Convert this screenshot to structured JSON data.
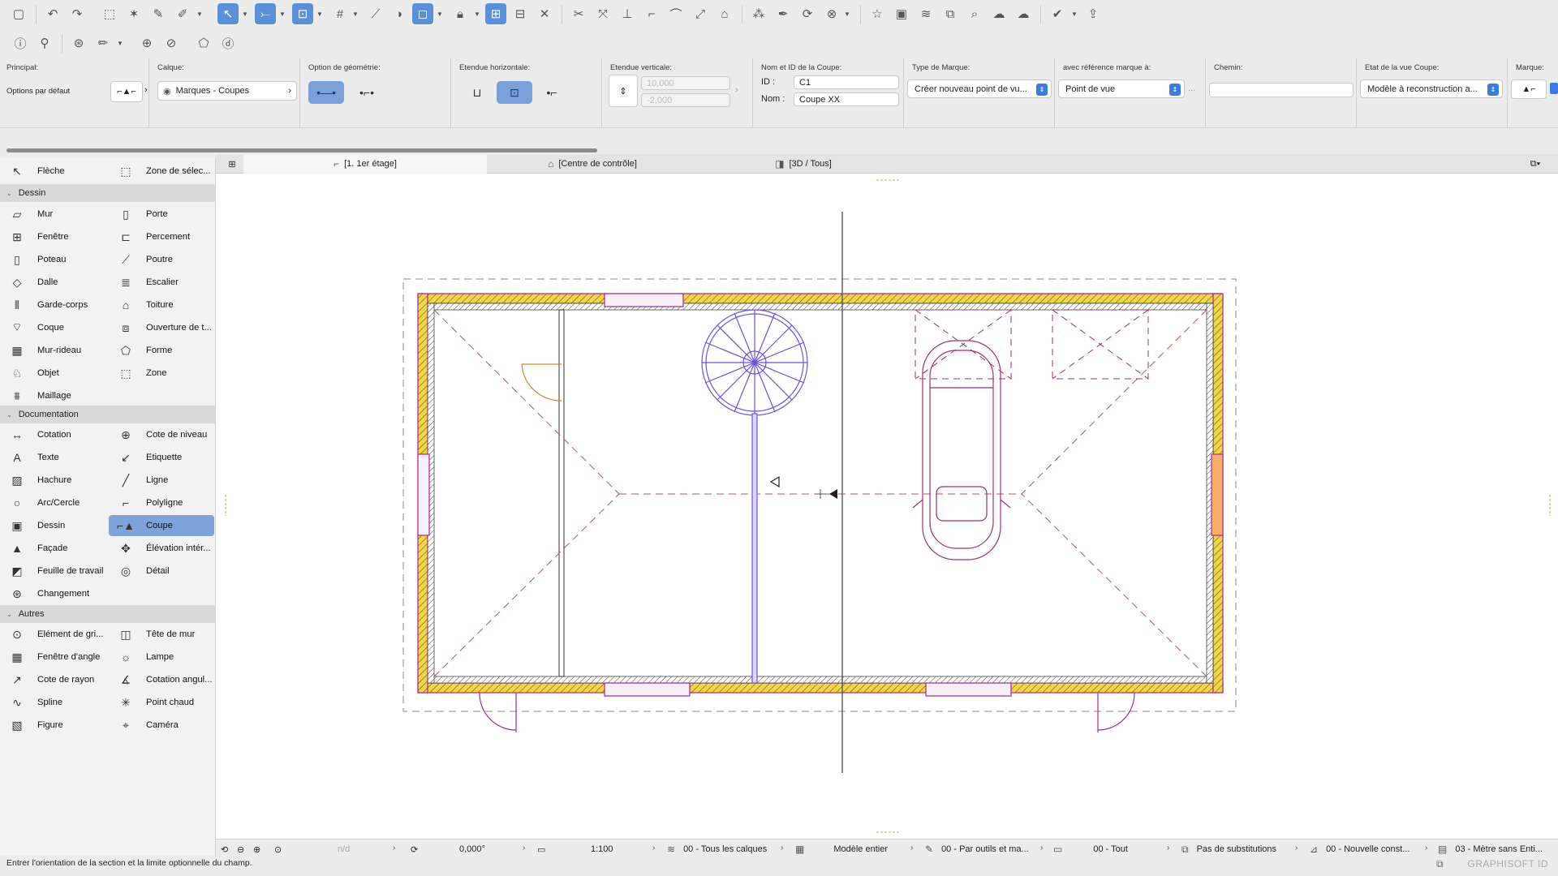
{
  "infobox": {
    "principal": {
      "title": "Principal:",
      "value": "Options par défaut"
    },
    "calque": {
      "title": "Calque:",
      "value": "Marques - Coupes"
    },
    "geometrie": {
      "title": "Option de géométrie:"
    },
    "etendue_h": {
      "title": "Etendue horizontale:"
    },
    "etendue_v": {
      "title": "Etendue verticale:",
      "top": "10,000",
      "bottom": "-2,000"
    },
    "nom_id": {
      "title": "Nom et ID de la Coupe:",
      "id_label": "ID :",
      "id_value": "C1",
      "nom_label": "Nom :",
      "nom_value": "Coupe XX"
    },
    "type_marque": {
      "title": "Type de Marque:",
      "value": "Créer nouveau point de vu..."
    },
    "reference": {
      "title": "avec référence marque à:",
      "value": "Point de vue",
      "more": "..."
    },
    "chemin": {
      "title": "Chemin:",
      "value": ""
    },
    "etat": {
      "title": "Etat de la vue Coupe:",
      "value": "Modèle à reconstruction a..."
    },
    "marque": {
      "title": "Marque:"
    }
  },
  "tabs": [
    {
      "label": "[1. 1er étage]",
      "icon": "floorplan-icon"
    },
    {
      "label": "[Centre de contrôle]",
      "icon": "control-center-icon"
    },
    {
      "label": "[3D / Tous]",
      "icon": "3d-view-icon"
    }
  ],
  "toolbox": {
    "top": [
      {
        "label": "Flèche",
        "icon": "arrow-icon"
      },
      {
        "label": "Zone de sélec...",
        "icon": "marquee-icon"
      }
    ],
    "sections": {
      "dessin": "Dessin",
      "documentation": "Documentation",
      "autres": "Autres"
    },
    "dessin_left": [
      "Mur",
      "Fenêtre",
      "Poteau",
      "Dalle",
      "Garde-corps",
      "Coque",
      "Mur-rideau",
      "Objet",
      "Maillage"
    ],
    "dessin_right": [
      "Porte",
      "Percement",
      "Poutre",
      "Escalier",
      "Toiture",
      "Ouverture de t...",
      "Forme",
      "Zone"
    ],
    "doc_left": [
      "Cotation",
      "Texte",
      "Hachure",
      "Arc/Cercle",
      "Dessin",
      "Façade",
      "Feuille de travail",
      "Changement"
    ],
    "doc_right": [
      "Cote de niveau",
      "Etiquette",
      "Ligne",
      "Polyligne",
      "Coupe",
      "Élévation intér...",
      "Détail"
    ],
    "autres_left": [
      "Elément de gri...",
      "Fenêtre d'angle",
      "Cote de rayon",
      "Spline",
      "Figure"
    ],
    "autres_right": [
      "Tête de mur",
      "Lampe",
      "Cotation angul...",
      "Point chaud",
      "Caméra"
    ]
  },
  "statusbar": {
    "nd": "n/d",
    "angle": "0,000°",
    "scale": "1:100",
    "layers": "00 - Tous les calques",
    "model": "Modèle entier",
    "pens": "00 - Par outils et ma...",
    "all": "00 - Tout",
    "substitutions": "Pas de substitutions",
    "renovation": "00 - Nouvelle const...",
    "dimension": "03 - Mètre sans Enti..."
  },
  "hint": "Entrer l'orientation de la section et la limite optionnelle du champ.",
  "brand": "GRAPHISOFT ID",
  "colors": {
    "accent": "#5b8fd8",
    "selected": "#7ea3d8",
    "wall_fill": "#f1d64b",
    "wall_edge": "#b1248f",
    "stair": "#6f52d8",
    "section_line": "#555555"
  }
}
